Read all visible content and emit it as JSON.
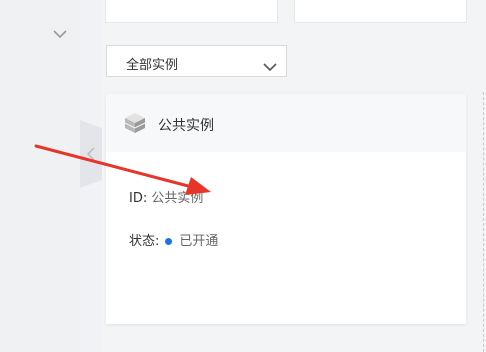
{
  "filter": {
    "selected": "全部实例"
  },
  "instance_card": {
    "title": "公共实例",
    "id_label": "ID:",
    "id_value": "公共实例",
    "status_label": "状态:",
    "status_value": "已开通",
    "status_color": "#1a73e8"
  },
  "annotation": {
    "color": "#e8352a"
  }
}
